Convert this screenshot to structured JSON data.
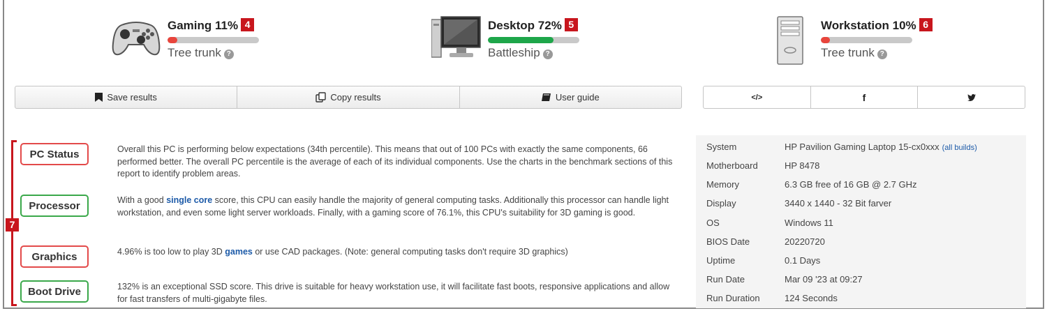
{
  "usage": [
    {
      "title": "Gaming 11%",
      "marker": "4",
      "sub": "Tree trunk",
      "percent": 11,
      "bar_color": "#e8453c",
      "icon": "gamepad-icon"
    },
    {
      "title": "Desktop 72%",
      "marker": "5",
      "sub": "Battleship",
      "percent": 72,
      "bar_color": "#1ea64a",
      "icon": "monitor-icon"
    },
    {
      "title": "Workstation 10%",
      "marker": "6",
      "sub": "Tree trunk",
      "percent": 10,
      "bar_color": "#e8453c",
      "icon": "tower-pc-icon"
    }
  ],
  "help_glyph": "?",
  "toolbar": {
    "save": "Save results",
    "copy": "Copy results",
    "guide": "User guide"
  },
  "share": {
    "embed": "</>",
    "facebook": "f",
    "twitter": "y"
  },
  "section_marker": "7",
  "status": {
    "pc": {
      "label": "PC Status",
      "text": "Overall this PC is performing below expectations (34th percentile). This means that out of 100 PCs with exactly the same components, 66 performed better. The overall PC percentile is the average of each of its individual components. Use the charts in the benchmark sections of this report to identify problem areas."
    },
    "processor": {
      "label": "Processor",
      "text_a": "With a good ",
      "link": "single core",
      "text_b": " score, this CPU can easily handle the majority of general computing tasks. Additionally this processor can handle light workstation, and even some light server workloads. Finally, with a gaming score of 76.1%, this CPU's suitability for 3D gaming is good."
    },
    "graphics": {
      "label": "Graphics",
      "text_a": "4.96% is too low to play 3D ",
      "link": "games",
      "text_b": " or use CAD packages. (Note: general computing tasks don't require 3D graphics)"
    },
    "boot": {
      "label": "Boot Drive",
      "text": "132% is an exceptional SSD score. This drive is suitable for heavy workstation use, it will facilitate fast boots, responsive applications and allow for fast transfers of multi-gigabyte files."
    }
  },
  "system": {
    "rows": [
      {
        "key": "System",
        "value": "HP Pavilion Gaming Laptop 15-cx0xxx",
        "extra": "(all builds)"
      },
      {
        "key": "Motherboard",
        "value": "HP 8478"
      },
      {
        "key": "Memory",
        "value": "6.3 GB free of 16 GB @ 2.7 GHz"
      },
      {
        "key": "Display",
        "value": "3440 x 1440 - 32 Bit farver"
      },
      {
        "key": "OS",
        "value": "Windows 11"
      },
      {
        "key": "BIOS Date",
        "value": "20220720"
      },
      {
        "key": "Uptime",
        "value": "0.1 Days"
      },
      {
        "key": "Run Date",
        "value": "Mar 09 '23 at 09:27"
      },
      {
        "key": "Run Duration",
        "value": "124 Seconds"
      }
    ]
  },
  "colors": {
    "marker_red": "#c8161d",
    "bad_border": "#e34a4a",
    "good_border": "#3aa84a",
    "link_blue": "#1c5aa8"
  }
}
